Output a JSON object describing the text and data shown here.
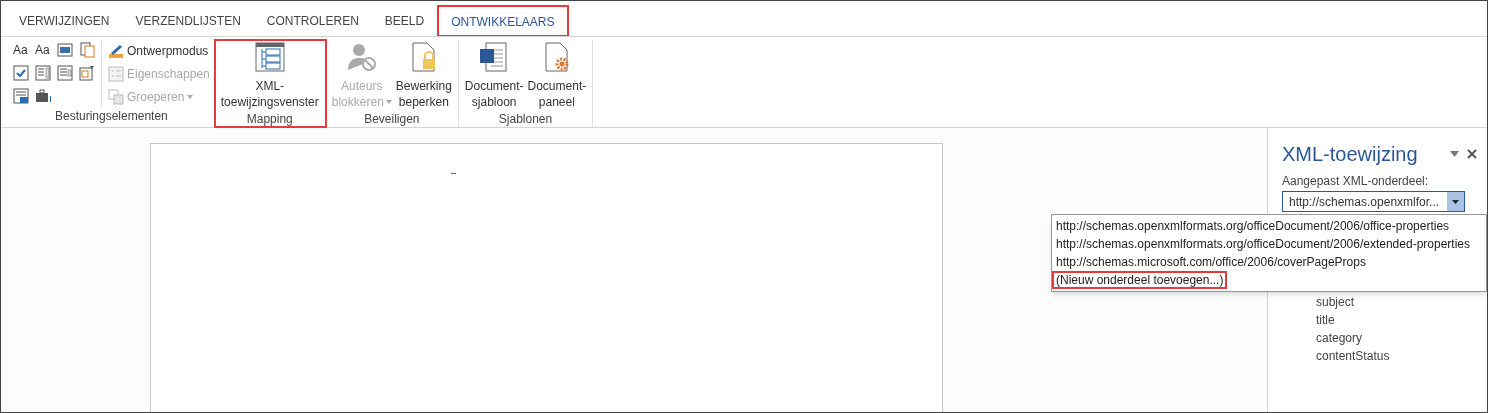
{
  "tabs": [
    {
      "label": "VERWIJZINGEN",
      "selected": false,
      "highlighted": false
    },
    {
      "label": "VERZENDLIJSTEN",
      "selected": false,
      "highlighted": false
    },
    {
      "label": "CONTROLEREN",
      "selected": false,
      "highlighted": false
    },
    {
      "label": "BEELD",
      "selected": false,
      "highlighted": false
    },
    {
      "label": "ONTWIKKELAARS",
      "selected": true,
      "highlighted": true
    }
  ],
  "ribbon_groups": [
    {
      "label": "Besturingselementen",
      "kind": "controls",
      "highlighted": false,
      "small_controls": [
        {
          "kind": "glyph",
          "label": "Aa"
        },
        {
          "kind": "glyph",
          "label": "Aa"
        },
        {
          "kind": "icon"
        },
        {
          "kind": "icon"
        },
        {
          "kind": "icon"
        },
        {
          "kind": "icon"
        },
        {
          "kind": "icon"
        },
        {
          "kind": "icon"
        },
        {
          "kind": "icon"
        },
        {
          "kind": "icon"
        }
      ],
      "commands": [
        {
          "label": "Ontwerpmodus",
          "disabled": false,
          "dropdown": false
        },
        {
          "label": "Eigenschappen",
          "disabled": true,
          "dropdown": false
        },
        {
          "label": "Groeperen",
          "disabled": true,
          "dropdown": true
        }
      ]
    },
    {
      "label": "Mapping",
      "kind": "large",
      "highlighted": true,
      "commands": [
        {
          "lines": [
            "XML-",
            "toewijzingsvenster"
          ],
          "disabled": false,
          "dropdown": false
        }
      ]
    },
    {
      "label": "Beveiligen",
      "kind": "large",
      "highlighted": false,
      "commands": [
        {
          "lines": [
            "Auteurs",
            "blokkeren"
          ],
          "disabled": true,
          "dropdown": true
        },
        {
          "lines": [
            "Bewerking",
            "beperken"
          ],
          "disabled": false,
          "dropdown": false
        }
      ]
    },
    {
      "label": "Sjablonen",
      "kind": "large",
      "highlighted": false,
      "commands": [
        {
          "lines": [
            "Document-",
            "sjabloon"
          ],
          "disabled": false,
          "dropdown": false
        },
        {
          "lines": [
            "Document-",
            "paneel"
          ],
          "disabled": false,
          "dropdown": false
        }
      ]
    }
  ],
  "task_pane": {
    "title": "XML-toewijzing",
    "field_label": "Aangepast XML-onderdeel:",
    "select_value": "http://schemas.openxmlfor...",
    "dropdown_options": [
      {
        "label": "http://schemas.openxmlformats.org/officeDocument/2006/office-properties",
        "highlighted": false
      },
      {
        "label": "http://schemas.openxmlformats.org/officeDocument/2006/extended-properties",
        "highlighted": false
      },
      {
        "label": "http://schemas.microsoft.com/office/2006/coverPageProps",
        "highlighted": false
      },
      {
        "label": "(Nieuw onderdeel toevoegen...)",
        "highlighted": true
      }
    ],
    "tree_items": [
      "subject",
      "title",
      "category",
      "contentStatus"
    ]
  }
}
